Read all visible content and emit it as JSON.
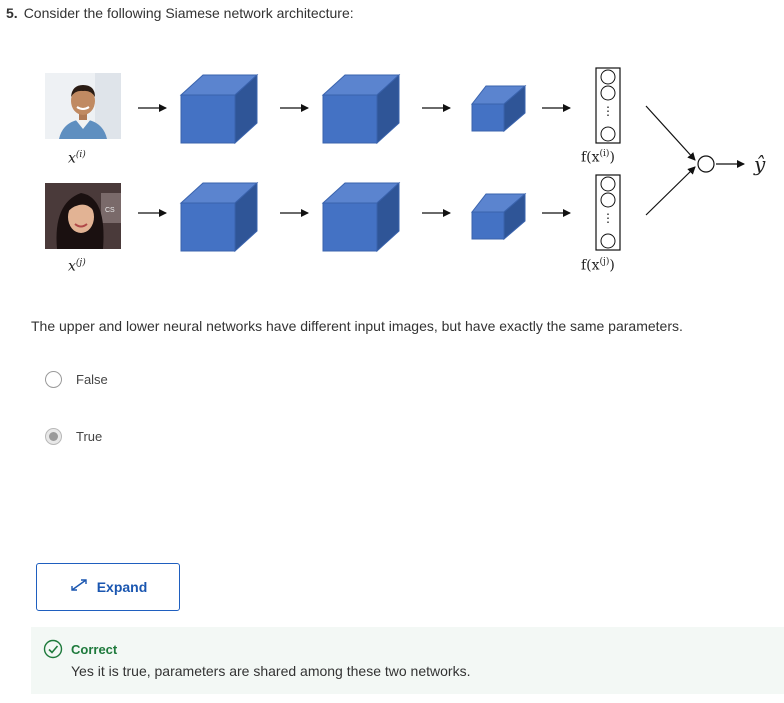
{
  "question": {
    "number": "5.",
    "prompt": "Consider the following Siamese network architecture:"
  },
  "diagram": {
    "input_top_label": "x",
    "input_top_sup": "(i)",
    "input_bottom_label": "x",
    "input_bottom_sup": "(j)",
    "encoding_top_label_prefix": "f(x",
    "encoding_top_sup": "(i)",
    "encoding_bottom_label_prefix": "f(x",
    "encoding_bottom_sup": "(j)",
    "label_suffix": ")",
    "output_label": "ŷ",
    "vector_ellipsis": "⋮",
    "photo_badge": "CS",
    "colors": {
      "cube_front": "#4472c4",
      "cube_top": "#5b84cf",
      "cube_side": "#2f5597",
      "edge": "#3a63ad"
    }
  },
  "statement": "The upper and lower neural networks have different input images, but have exactly the same parameters.",
  "options": [
    {
      "label": "False",
      "selected": false
    },
    {
      "label": "True",
      "selected": true
    }
  ],
  "expand_button": {
    "label": "Expand",
    "icon": "expand-arrows-icon"
  },
  "feedback": {
    "status": "Correct",
    "message": "Yes it is true, parameters are shared among these two networks.",
    "icon": "check-circle-icon",
    "accent": "#1e7a3c"
  }
}
